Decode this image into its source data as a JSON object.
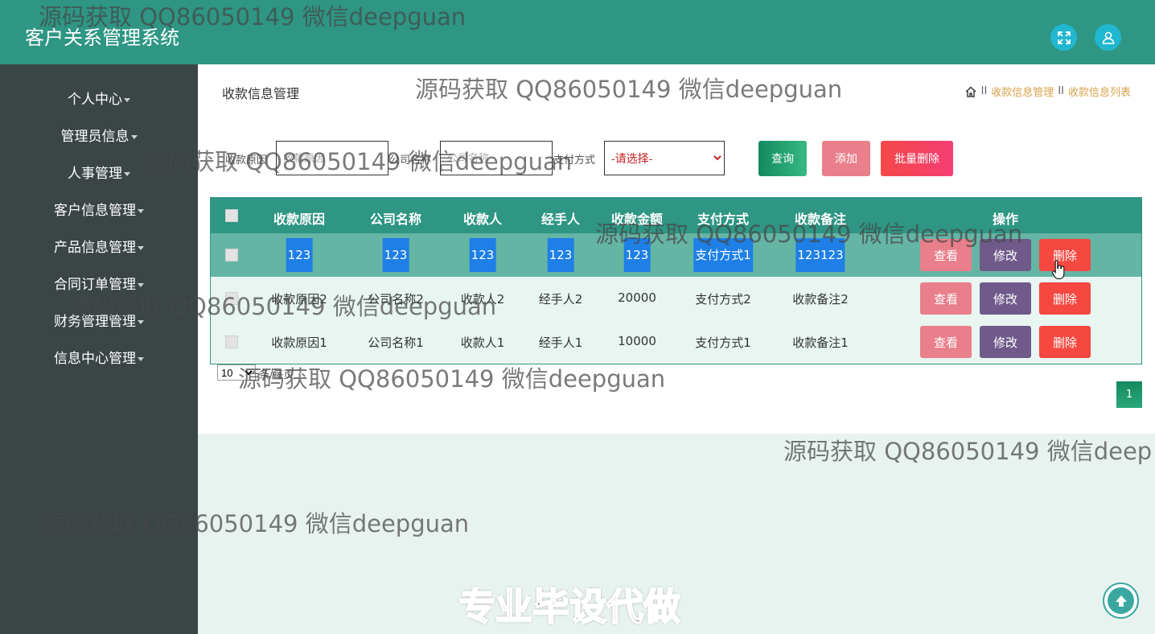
{
  "app": {
    "title": "客户关系管理系统"
  },
  "topbar": {
    "icons": [
      "fullscreen-icon",
      "user-icon"
    ]
  },
  "sidebar": {
    "items": [
      {
        "label": "个人中心"
      },
      {
        "label": "管理员信息"
      },
      {
        "label": "人事管理"
      },
      {
        "label": "客户信息管理"
      },
      {
        "label": "产品信息管理"
      },
      {
        "label": "合同订单管理"
      },
      {
        "label": "财务管理管理"
      },
      {
        "label": "信息中心管理"
      }
    ]
  },
  "page": {
    "title": "收款信息管理",
    "breadcrumb": [
      "收款信息管理",
      "收款信息列表"
    ]
  },
  "search": {
    "reason_label": "收款原因",
    "reason_placeholder": "收款原因",
    "company_label": "公司名称",
    "company_placeholder": "公司名称",
    "payment_label": "支付方式",
    "payment_selected": "-请选择-",
    "query_button": "查询",
    "add_button": "添加",
    "batch_delete_button": "批量删除"
  },
  "table": {
    "columns": [
      "收款原因",
      "公司名称",
      "收款人",
      "经手人",
      "收款金额",
      "支付方式",
      "收款备注",
      "操作"
    ],
    "rows": [
      {
        "reason": "123",
        "company": "123",
        "payee": "123",
        "handler": "123",
        "amount": "123",
        "method": "支付方式1",
        "remark": "123123"
      },
      {
        "reason": "收款原因2",
        "company": "公司名称2",
        "payee": "收款人2",
        "handler": "经手人2",
        "amount": "20000",
        "method": "支付方式2",
        "remark": "收款备注2"
      },
      {
        "reason": "收款原因1",
        "company": "公司名称1",
        "payee": "收款人1",
        "handler": "经手人1",
        "amount": "10000",
        "method": "支付方式1",
        "remark": "收款备注1"
      }
    ],
    "actions": {
      "view": "查看",
      "edit": "修改",
      "delete": "删除"
    }
  },
  "pager": {
    "page_size": "10",
    "page_size_suffix": "条/每页",
    "current_page": "1"
  },
  "overlay": {
    "watermark": "源码获取 QQ86050149 微信deepguan",
    "watermark_cut": "源码获取 QQ86050149 微信deep",
    "promo": "专业毕设代做"
  },
  "colors": {
    "header": "#2e9683",
    "sidebar": "#3b4546",
    "accent_link": "#d6a24a",
    "delete": "#f54840",
    "edit": "#6f5a8a",
    "view": "#e87f8a"
  }
}
